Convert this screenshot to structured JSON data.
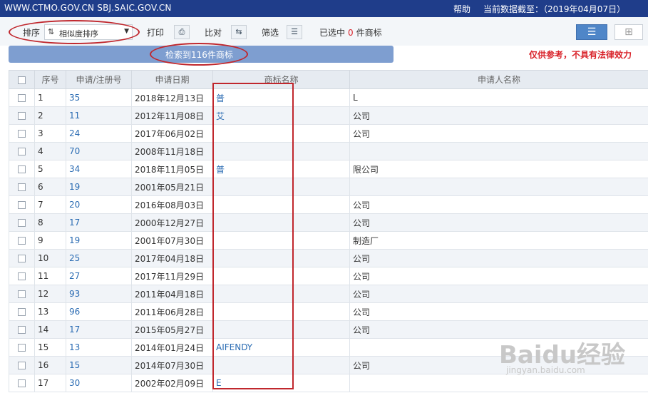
{
  "topbar": {
    "site": "WWW.CTMO.GOV.CN SBJ.SAIC.GOV.CN",
    "help": "帮助",
    "as_of": "当前数据截至：（2019年04月07日）"
  },
  "toolbar": {
    "sort_label": "排序",
    "sort_value": "相似度排序",
    "print_label": "打印",
    "compare_label": "比对",
    "filter_label": "筛选",
    "selected_prefix": "已选中",
    "selected_count": "0",
    "selected_suffix": "件商标"
  },
  "result": {
    "text": "检索到116件商标",
    "disclaimer": "仅供参考，不具有法律效力"
  },
  "table": {
    "headers": {
      "index": "序号",
      "regno": "申请/注册号",
      "date": "申请日期",
      "trademark": "商标名称",
      "applicant": "申请人名称"
    },
    "rows": [
      {
        "index": "1",
        "regno": "35",
        "date": "2018年12月13日",
        "trademark": "普",
        "applicant": "L"
      },
      {
        "index": "2",
        "regno": "11",
        "date": "2012年11月08日",
        "trademark": "艾",
        "applicant": "公司"
      },
      {
        "index": "3",
        "regno": "24",
        "date": "2017年06月02日",
        "trademark": "",
        "applicant": "公司"
      },
      {
        "index": "4",
        "regno": "70",
        "date": "2008年11月18日",
        "trademark": "",
        "applicant": ""
      },
      {
        "index": "5",
        "regno": "34",
        "date": "2018年11月05日",
        "trademark": "普",
        "applicant": "限公司"
      },
      {
        "index": "6",
        "regno": "19",
        "date": "2001年05月21日",
        "trademark": "",
        "applicant": ""
      },
      {
        "index": "7",
        "regno": "20",
        "date": "2016年08月03日",
        "trademark": "",
        "applicant": "公司"
      },
      {
        "index": "8",
        "regno": "17",
        "date": "2000年12月27日",
        "trademark": "",
        "applicant": "公司"
      },
      {
        "index": "9",
        "regno": "19",
        "date": "2001年07月30日",
        "trademark": "",
        "applicant": "制造厂"
      },
      {
        "index": "10",
        "regno": "25",
        "date": "2017年04月18日",
        "trademark": "",
        "applicant": "公司"
      },
      {
        "index": "11",
        "regno": "27",
        "date": "2017年11月29日",
        "trademark": "",
        "applicant": "公司"
      },
      {
        "index": "12",
        "regno": "93",
        "date": "2011年04月18日",
        "trademark": "",
        "applicant": "公司"
      },
      {
        "index": "13",
        "regno": "96",
        "date": "2011年06月28日",
        "trademark": "",
        "applicant": "公司"
      },
      {
        "index": "14",
        "regno": "17",
        "date": "2015年05月27日",
        "trademark": "",
        "applicant": "公司"
      },
      {
        "index": "15",
        "regno": "13",
        "date": "2014年01月24日",
        "trademark": "AIFENDY",
        "applicant": ""
      },
      {
        "index": "16",
        "regno": "15",
        "date": "2014年07月30日",
        "trademark": "",
        "applicant": "公司"
      },
      {
        "index": "17",
        "regno": "30",
        "date": "2002年02月09日",
        "trademark": "E",
        "applicant": ""
      }
    ]
  },
  "watermark": {
    "brand": "Baidu经验",
    "url": "jingyan.baidu.com"
  }
}
